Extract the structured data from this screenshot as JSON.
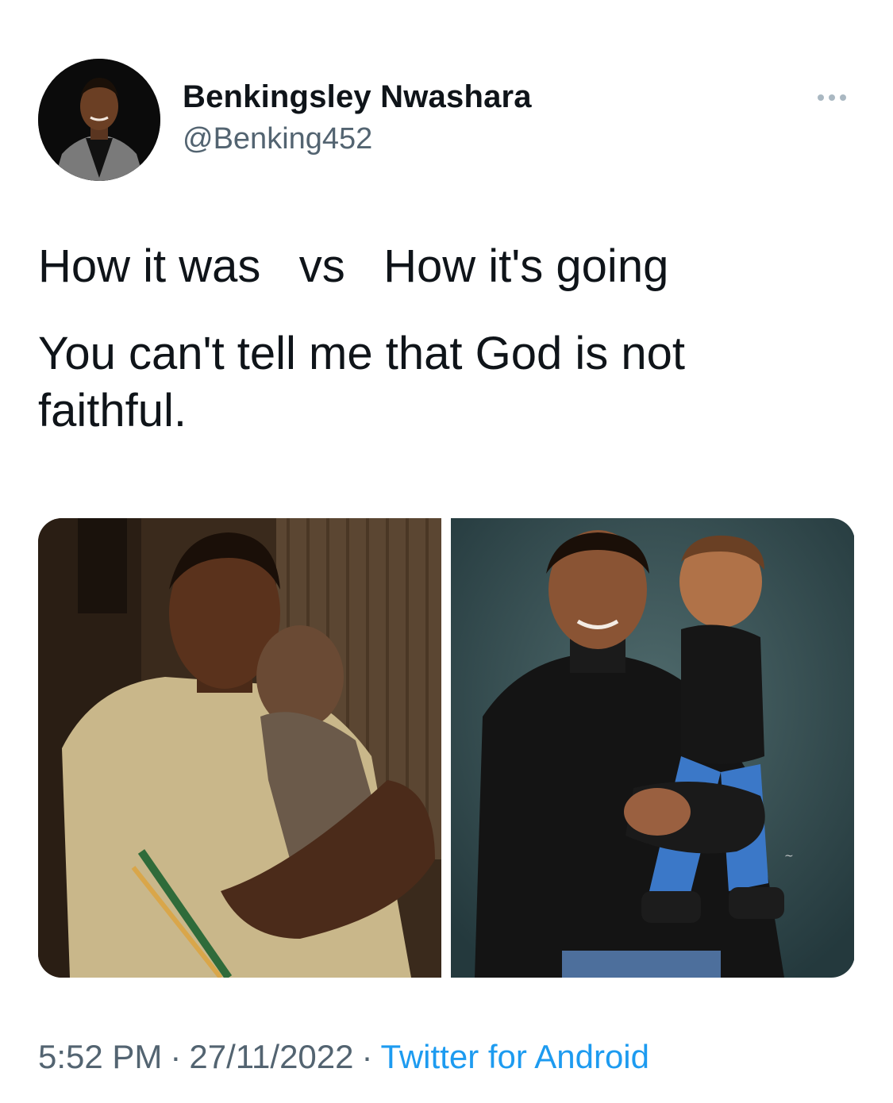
{
  "tweet": {
    "author": {
      "display_name": "Benkingsley Nwashara",
      "handle": "@Benking452"
    },
    "text_lines": [
      "How it was   vs   How it's going",
      "You can't tell me that God is not",
      "faithful."
    ],
    "media": [
      {
        "label": "photo-before"
      },
      {
        "label": "photo-after"
      }
    ],
    "meta": {
      "time": "5:52 PM",
      "separator": "·",
      "date": "27/11/2022",
      "source": "Twitter for Android"
    }
  },
  "colors": {
    "text_primary": "#0f1419",
    "text_secondary": "#536471",
    "link": "#1d9bf0",
    "more_dots": "#aab8c2"
  },
  "icons": [
    "more-icon"
  ]
}
